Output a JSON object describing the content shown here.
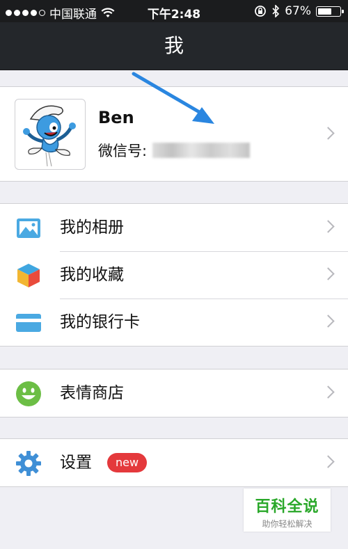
{
  "status_bar": {
    "carrier": "中国联通",
    "time": "下午2:48",
    "battery": "67%",
    "battery_level": 0.67,
    "signal_bars_filled": 4,
    "signal_bars_total": 5
  },
  "nav": {
    "title": "我"
  },
  "profile": {
    "name": "Ben",
    "wechat_label": "微信号:"
  },
  "menu_group1": [
    {
      "label": "我的相册",
      "icon": "photo-album-icon",
      "color": "#4aa9e2"
    },
    {
      "label": "我的收藏",
      "icon": "favorites-cube-icon",
      "color": "#e94b3c"
    },
    {
      "label": "我的银行卡",
      "icon": "bank-card-icon",
      "color": "#4aa9e2"
    }
  ],
  "menu_group2": [
    {
      "label": "表情商店",
      "icon": "smiley-icon",
      "color": "#6cbe45"
    }
  ],
  "menu_group3": [
    {
      "label": "设置",
      "icon": "gear-icon",
      "color": "#3f8fd6",
      "badge": "new"
    }
  ],
  "watermark": {
    "title": "百科全说",
    "subtitle": "助你轻松解决"
  },
  "colors": {
    "nav_bg": "#24272b",
    "page_bg": "#efeff4",
    "badge": "#e4393c",
    "arrow": "#2a86e0"
  }
}
